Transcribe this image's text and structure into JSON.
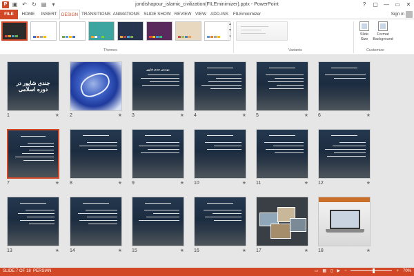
{
  "window": {
    "title": "jondishapour_islamic_civilization(FILEminimizer).pptx - PowerPoint",
    "app_letter": "P",
    "controls": [
      "?",
      "▢",
      "—",
      "▭",
      "✕"
    ]
  },
  "ribbon_tabs": [
    {
      "label": "FILE"
    },
    {
      "label": "HOME"
    },
    {
      "label": "INSERT"
    },
    {
      "label": "DESIGN"
    },
    {
      "label": "TRANSITIONS"
    },
    {
      "label": "ANIMATIONS"
    },
    {
      "label": "SLIDE SHOW"
    },
    {
      "label": "REVIEW"
    },
    {
      "label": "VIEW"
    },
    {
      "label": "ADD-INS"
    },
    {
      "label": "FILEminimizer"
    }
  ],
  "active_tab": "DESIGN",
  "signin": "Sign in",
  "groups": {
    "themes": "Themes",
    "variants": "Variants",
    "customize": "Customize"
  },
  "customize_buttons": {
    "slide_size": "Slide Size",
    "format_background": "Format Background"
  },
  "theme_colors": [
    {
      "bg": "#2b2b2b",
      "fg": "#ffffff",
      "bars": [
        "#e34a33",
        "#f0a030",
        "#50a0d0",
        "#6ab04c"
      ]
    },
    {
      "bg": "#ffffff",
      "fg": "#333333",
      "bars": [
        "#4472c4",
        "#ed7d31",
        "#a5a5a5",
        "#ffc000"
      ]
    },
    {
      "bg": "#ffffff",
      "fg": "#333333",
      "bars": [
        "#70ad47",
        "#5b9bd5",
        "#ffc000",
        "#4472c4"
      ]
    },
    {
      "bg": "#3ca5a0",
      "fg": "#ffffff",
      "bars": [
        "#f5a623",
        "#ffffff",
        "#4a90e2",
        "#7ed321"
      ]
    },
    {
      "bg": "#26344f",
      "fg": "#ffffff",
      "bars": [
        "#e8a33d",
        "#c7483d",
        "#4d9ed8",
        "#7fb04c"
      ]
    },
    {
      "bg": "#5a2a5c",
      "fg": "#ffffff",
      "bars": [
        "#e0483e",
        "#f1c40f",
        "#3498db",
        "#2ecc71"
      ]
    },
    {
      "bg": "#e8d8c0",
      "fg": "#333333",
      "bars": [
        "#c0504d",
        "#9bbb59",
        "#4f81bd",
        "#f79646"
      ]
    },
    {
      "bg": "#ffffff",
      "fg": "#333333",
      "bars": [
        "#5b9bd5",
        "#ed7d31",
        "#a5a5a5",
        "#ffc000"
      ]
    }
  ],
  "slides": [
    {
      "num": "1",
      "kind": "dark",
      "title": "جندی شاپور در دوره اسلامی",
      "big": true,
      "lines": 0
    },
    {
      "num": "2",
      "kind": "art",
      "title": "",
      "lines": 0
    },
    {
      "num": "3",
      "kind": "dark",
      "title": "موسس جندی شاپور",
      "lines": 4
    },
    {
      "num": "4",
      "kind": "dark",
      "title": "",
      "lines": 5
    },
    {
      "num": "5",
      "kind": "dark",
      "title": "",
      "lines": 5
    },
    {
      "num": "6",
      "kind": "dark",
      "title": "",
      "lines": 2
    },
    {
      "num": "7",
      "kind": "dark",
      "title": "",
      "lines": 6,
      "selected": true
    },
    {
      "num": "8",
      "kind": "dark",
      "title": "",
      "lines": 3
    },
    {
      "num": "9",
      "kind": "dark",
      "title": "",
      "lines": 4
    },
    {
      "num": "10",
      "kind": "dark",
      "title": "",
      "lines": 3
    },
    {
      "num": "11",
      "kind": "dark",
      "title": "",
      "lines": 4
    },
    {
      "num": "12",
      "kind": "dark",
      "title": "",
      "lines": 5
    },
    {
      "num": "13",
      "kind": "dark",
      "title": "",
      "lines": 5
    },
    {
      "num": "14",
      "kind": "dark",
      "title": "",
      "lines": 5
    },
    {
      "num": "15",
      "kind": "dark",
      "title": "",
      "lines": 4
    },
    {
      "num": "16",
      "kind": "dark",
      "title": "",
      "lines": 4
    },
    {
      "num": "17",
      "kind": "photo",
      "title": "",
      "lines": 0
    },
    {
      "num": "18",
      "kind": "laptop",
      "title": "",
      "lines": 0
    }
  ],
  "star": "★",
  "status": {
    "slide_info": "SLIDE 7 OF 18",
    "language": "PERSIAN",
    "zoom": "70%",
    "zoom_fraction": 0.55
  }
}
